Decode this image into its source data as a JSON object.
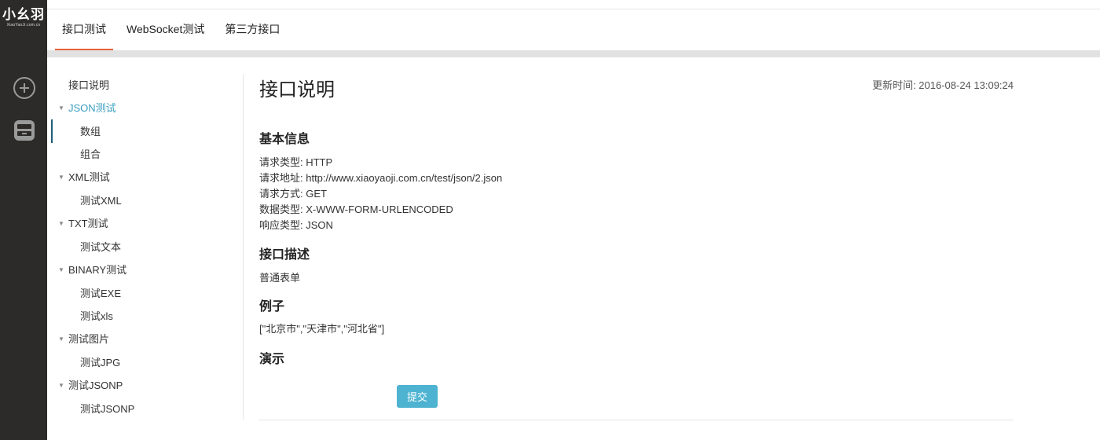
{
  "rail": {
    "logo_main": "小幺羽",
    "logo_sub": "XiaoYaoJi.com.cn",
    "add_icon": "plus-circle-icon",
    "box_icon": "inbox-icon"
  },
  "tabs": [
    {
      "label": "接口测试",
      "active": true
    },
    {
      "label": "WebSocket测试",
      "active": false
    },
    {
      "label": "第三方接口",
      "active": false
    }
  ],
  "tree": {
    "intro": "接口说明",
    "groups": [
      {
        "label": "JSON测试",
        "items": [
          "数组",
          "组合"
        ]
      },
      {
        "label": "XML测试",
        "items": [
          "测试XML"
        ]
      },
      {
        "label": "TXT测试",
        "items": [
          "测试文本"
        ]
      },
      {
        "label": "BINARY测试",
        "items": [
          "测试EXE",
          "测试xls"
        ]
      },
      {
        "label": "测试图片",
        "items": [
          "测试JPG"
        ]
      },
      {
        "label": "测试JSONP",
        "items": [
          "测试JSONP"
        ]
      }
    ],
    "selected": "数组"
  },
  "main": {
    "title": "接口说明",
    "updated_label": "更新时间: 2016-08-24 13:09:24",
    "basic_heading": "基本信息",
    "basic_lines": [
      "请求类型: HTTP",
      "请求地址: http://www.xiaoyaoji.com.cn/test/json/2.json",
      "请求方式: GET",
      "数据类型: X-WWW-FORM-URLENCODED",
      "响应类型: JSON"
    ],
    "desc_heading": "接口描述",
    "desc_text": "普通表单",
    "example_heading": "例子",
    "example_text": "[\"北京市\",\"天津市\",\"河北省\"]",
    "demo_heading": "演示",
    "submit_label": "提交"
  },
  "colors": {
    "rail_bg": "#2d2b2a",
    "tab_accent": "#e8623a",
    "tree_active": "#3a9fc0",
    "submit_bg": "#4db3d1"
  }
}
